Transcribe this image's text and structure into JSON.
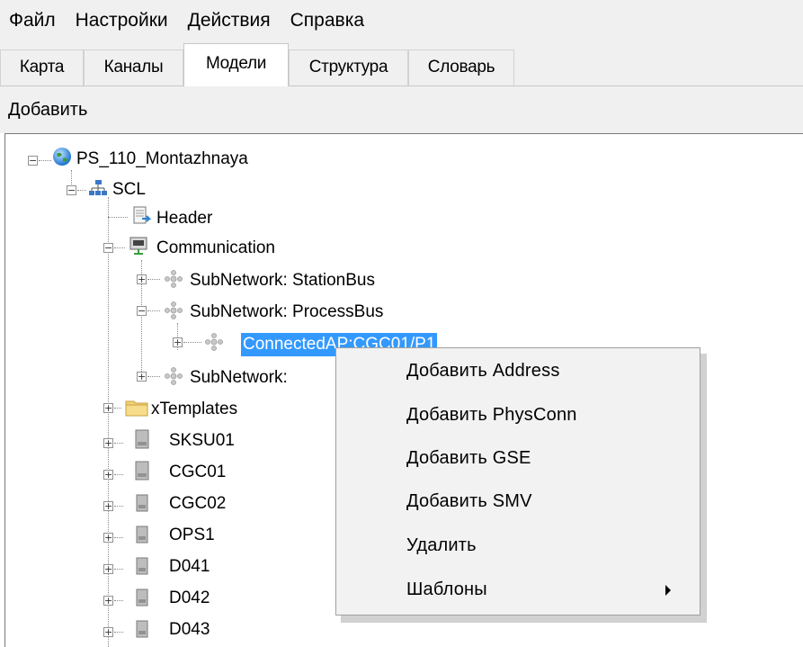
{
  "menubar": {
    "items": [
      "Файл",
      "Настройки",
      "Действия",
      "Справка"
    ]
  },
  "tabs": [
    "Карта",
    "Каналы",
    "Модели",
    "Структура",
    "Словарь"
  ],
  "active_tab": "Модели",
  "toolbar": {
    "add_label": "Добавить"
  },
  "tree": {
    "root": "PS_110_Montazhnaya",
    "scl": "SCL",
    "header": "Header",
    "communication": "Communication",
    "subnet1": "SubNetwork: StationBus",
    "subnet2": "SubNetwork: ProcessBus",
    "connected_ap": "ConnectedAP:CGC01/P1",
    "subnet3": "SubNetwork:",
    "xtemplates": "xTemplates",
    "ieds": [
      "SKSU01",
      "CGC01",
      "CGC02",
      "OPS1",
      "D041",
      "D042",
      "D043"
    ]
  },
  "context_menu": {
    "items": [
      "Добавить Address",
      "Добавить PhysConn",
      "Добавить GSE",
      "Добавить SMV",
      "Удалить",
      "Шаблоны"
    ]
  },
  "colors": {
    "selection": "#3399ff",
    "chrome": "#f0f0f0"
  }
}
